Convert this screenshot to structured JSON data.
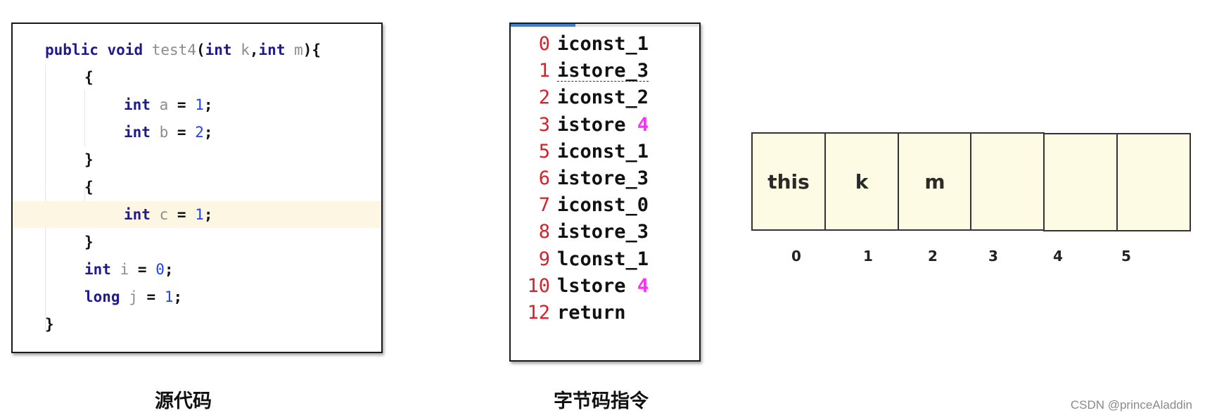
{
  "source_code": {
    "caption": "源代码",
    "lines": [
      {
        "indent": 0,
        "tokens": [
          {
            "t": "public",
            "c": "kw"
          },
          {
            "t": " "
          },
          {
            "t": "void",
            "c": "kw"
          },
          {
            "t": " "
          },
          {
            "t": "test4",
            "c": "id"
          },
          {
            "t": "(",
            "c": "pn"
          },
          {
            "t": "int",
            "c": "kw"
          },
          {
            "t": " "
          },
          {
            "t": "k",
            "c": "id"
          },
          {
            "t": ",",
            "c": "pn"
          },
          {
            "t": "int",
            "c": "kw"
          },
          {
            "t": " "
          },
          {
            "t": "m",
            "c": "id"
          },
          {
            "t": "){",
            "c": "pn"
          }
        ]
      },
      {
        "indent": 1,
        "tokens": [
          {
            "t": "{",
            "c": "pn"
          }
        ]
      },
      {
        "indent": 2,
        "tokens": [
          {
            "t": "int",
            "c": "kw"
          },
          {
            "t": " "
          },
          {
            "t": "a",
            "c": "id"
          },
          {
            "t": " = ",
            "c": "pn"
          },
          {
            "t": "1",
            "c": "num"
          },
          {
            "t": ";",
            "c": "pn"
          }
        ]
      },
      {
        "indent": 2,
        "tokens": [
          {
            "t": "int",
            "c": "kw"
          },
          {
            "t": " "
          },
          {
            "t": "b",
            "c": "id"
          },
          {
            "t": " = ",
            "c": "pn"
          },
          {
            "t": "2",
            "c": "num"
          },
          {
            "t": ";",
            "c": "pn"
          }
        ]
      },
      {
        "indent": 1,
        "tokens": [
          {
            "t": "}",
            "c": "pn"
          }
        ]
      },
      {
        "indent": 1,
        "tokens": [
          {
            "t": "{",
            "c": "pn"
          }
        ]
      },
      {
        "indent": 2,
        "highlight": true,
        "tokens": [
          {
            "t": "int",
            "c": "kw"
          },
          {
            "t": " "
          },
          {
            "t": "c",
            "c": "id"
          },
          {
            "t": " = ",
            "c": "pn"
          },
          {
            "t": "1",
            "c": "num"
          },
          {
            "t": ";",
            "c": "pn"
          }
        ]
      },
      {
        "indent": 1,
        "tokens": [
          {
            "t": "}",
            "c": "pn"
          }
        ]
      },
      {
        "indent": 1,
        "tokens": [
          {
            "t": "int",
            "c": "kw"
          },
          {
            "t": " "
          },
          {
            "t": "i",
            "c": "id"
          },
          {
            "t": " = ",
            "c": "pn"
          },
          {
            "t": "0",
            "c": "num"
          },
          {
            "t": ";",
            "c": "pn"
          }
        ]
      },
      {
        "indent": 1,
        "tokens": [
          {
            "t": "long",
            "c": "kw"
          },
          {
            "t": " "
          },
          {
            "t": "j",
            "c": "id"
          },
          {
            "t": " = ",
            "c": "pn"
          },
          {
            "t": "1",
            "c": "num"
          },
          {
            "t": ";",
            "c": "pn"
          }
        ]
      },
      {
        "indent": 0,
        "tokens": [
          {
            "t": "}",
            "c": "pn"
          }
        ]
      }
    ]
  },
  "bytecode": {
    "caption": "字节码指令",
    "instructions": [
      {
        "offset": "0",
        "op": "iconst_1",
        "arg": ""
      },
      {
        "offset": "1",
        "op": "istore_3",
        "arg": "",
        "underlined": true
      },
      {
        "offset": "2",
        "op": "iconst_2",
        "arg": ""
      },
      {
        "offset": "3",
        "op": "istore",
        "arg": "4"
      },
      {
        "offset": "5",
        "op": "iconst_1",
        "arg": ""
      },
      {
        "offset": "6",
        "op": "istore_3",
        "arg": ""
      },
      {
        "offset": "7",
        "op": "iconst_0",
        "arg": ""
      },
      {
        "offset": "8",
        "op": "istore_3",
        "arg": ""
      },
      {
        "offset": "9",
        "op": "lconst_1",
        "arg": ""
      },
      {
        "offset": "10",
        "op": "lstore",
        "arg": "4"
      },
      {
        "offset": "12",
        "op": "return",
        "arg": ""
      }
    ]
  },
  "local_variable_table": {
    "slots": [
      {
        "index": "0",
        "value": "this"
      },
      {
        "index": "1",
        "value": "k"
      },
      {
        "index": "2",
        "value": "m"
      },
      {
        "index": "3",
        "value": ""
      },
      {
        "index": "4",
        "value": ""
      },
      {
        "index": "5",
        "value": ""
      }
    ]
  },
  "colors": {
    "keyword": "#1f1a8e",
    "identifier": "#8c8c8c",
    "number": "#2040ff",
    "offset": "#d8202a",
    "bytecode_arg": "#ff2bff",
    "slot_fill": "#fdfbe3",
    "highlight_line": "#fdf6e3"
  },
  "watermark": "CSDN @princeAladdin"
}
